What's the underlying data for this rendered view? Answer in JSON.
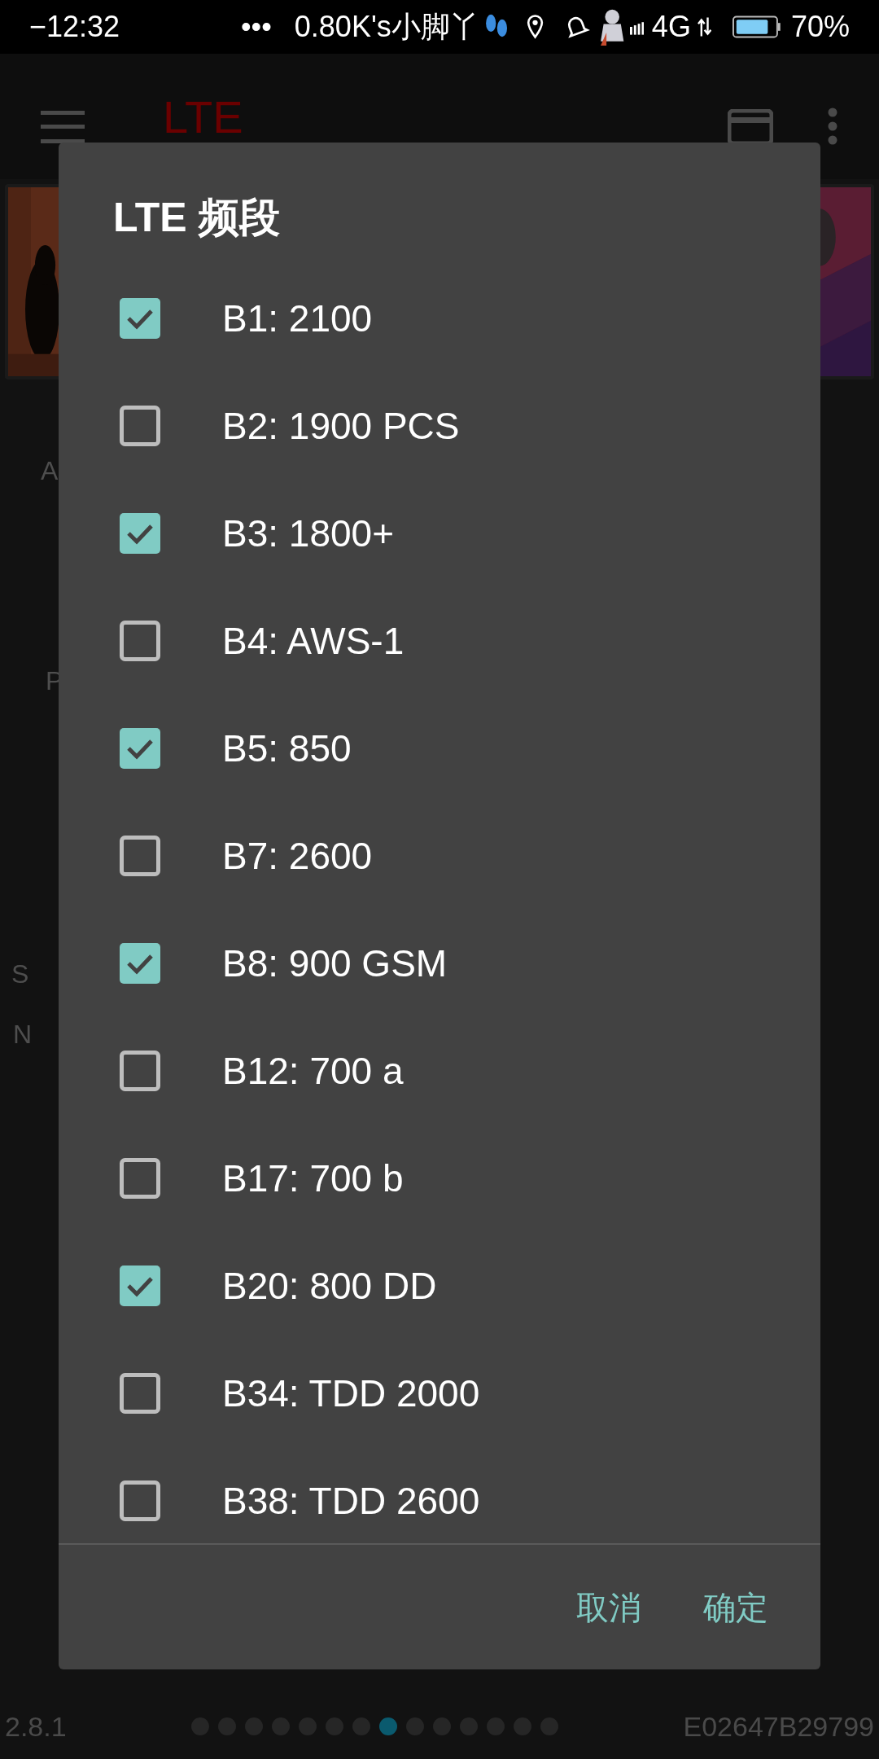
{
  "status_bar": {
    "time": "−12:32",
    "dots": "•••",
    "speed": "0.80K's",
    "carrier": "小脚丫",
    "network": "4G",
    "battery": "70%"
  },
  "app_bar": {
    "title": "LTE"
  },
  "background_labels": [
    "A",
    "P",
    "S",
    "N"
  ],
  "footer": {
    "version": "2.8.1",
    "device_id": "E02647B29799",
    "pages": [
      {
        "selected": false
      },
      {
        "selected": false
      },
      {
        "selected": false
      },
      {
        "selected": false
      },
      {
        "selected": false
      },
      {
        "selected": false
      },
      {
        "selected": false
      },
      {
        "selected": true
      },
      {
        "selected": false
      },
      {
        "selected": false
      },
      {
        "selected": false
      },
      {
        "selected": false
      },
      {
        "selected": false
      },
      {
        "selected": false
      }
    ]
  },
  "dialog": {
    "title": "LTE 频段",
    "options": [
      {
        "label": "B1: 2100",
        "checked": true
      },
      {
        "label": "B2: 1900 PCS",
        "checked": false
      },
      {
        "label": "B3: 1800+",
        "checked": true
      },
      {
        "label": "B4: AWS-1",
        "checked": false
      },
      {
        "label": "B5: 850",
        "checked": true
      },
      {
        "label": "B7: 2600",
        "checked": false
      },
      {
        "label": "B8: 900 GSM",
        "checked": true
      },
      {
        "label": "B12: 700 a",
        "checked": false
      },
      {
        "label": "B17: 700 b",
        "checked": false
      },
      {
        "label": "B20: 800 DD",
        "checked": true
      },
      {
        "label": "B34: TDD 2000",
        "checked": false
      },
      {
        "label": "B38: TDD 2600",
        "checked": false
      }
    ],
    "buttons": [
      "取消",
      "确定"
    ]
  }
}
